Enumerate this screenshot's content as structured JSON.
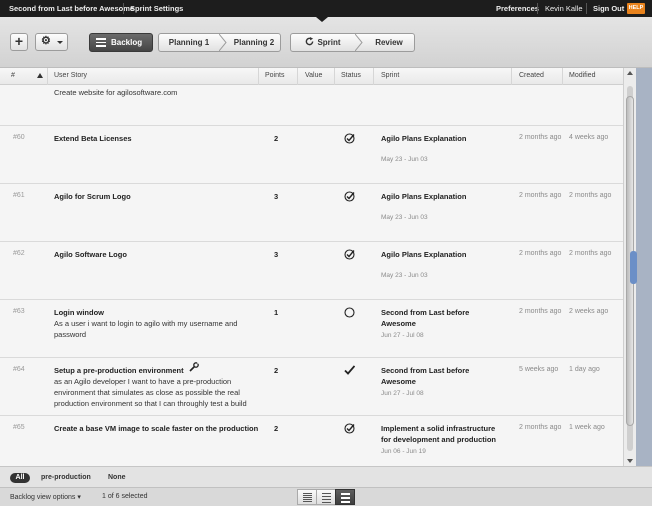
{
  "topbar": {
    "sprint_title": "Second from Last before Awesome",
    "sprint_settings": "Sprint Settings",
    "preferences": "Preferences",
    "user": "Kevin Kalle",
    "sign_out": "Sign Out",
    "help": "HELP"
  },
  "toolbar": {
    "add_label": "+",
    "gear_label": "⚙",
    "steps": {
      "backlog": "Backlog",
      "planning1": "Planning 1",
      "planning2": "Planning 2",
      "sprint": "Sprint",
      "review": "Review"
    }
  },
  "table": {
    "headers": {
      "id": "#",
      "story": "User Story",
      "points": "Points",
      "value": "Value",
      "status": "Status",
      "sprint": "Sprint",
      "created": "Created",
      "modified": "Modified"
    },
    "partial_row_desc": "Create website for agilosoftware.com",
    "rows": [
      {
        "id": "#60",
        "title": "Extend Beta Licenses",
        "desc": "",
        "points": "2",
        "status": "check-circle",
        "sprint": "Agilo Plans Explanation",
        "dates": "May 23 - Jun 03",
        "created": "2 months ago",
        "modified": "4 weeks ago"
      },
      {
        "id": "#61",
        "title": "Agilo for Scrum Logo",
        "desc": "",
        "points": "3",
        "status": "check-circle",
        "sprint": "Agilo Plans Explanation",
        "dates": "May 23 - Jun 03",
        "created": "2 months ago",
        "modified": "2 months ago"
      },
      {
        "id": "#62",
        "title": "Agilo Software Logo",
        "desc": "",
        "points": "3",
        "status": "check-circle",
        "sprint": "Agilo Plans Explanation",
        "dates": "May 23 - Jun 03",
        "created": "2 months ago",
        "modified": "2 months ago"
      },
      {
        "id": "#63",
        "title": "Login window",
        "desc": "As a user i want to login to agilo with my username and password",
        "points": "1",
        "status": "open-circle",
        "sprint": "Second from Last before Awesome",
        "dates": "Jun 27 - Jul 08",
        "created": "2 months ago",
        "modified": "2 weeks ago"
      },
      {
        "id": "#64",
        "title": "Setup a pre-production environment",
        "desc": "as an Agilo developer I want to have a pre-production environment that simulates as close as possible the real production environment so that I can throughly test a build",
        "points": "2",
        "status": "check",
        "sprint": "Second from Last before Awesome",
        "dates": "Jun 27 - Jul 08",
        "created": "5 weeks ago",
        "modified": "1 day ago"
      },
      {
        "id": "#65",
        "title": "Create a base VM image to scale faster on the production",
        "desc": "",
        "points": "2",
        "status": "check-circle",
        "sprint": "Implement a solid infrastructure for development and production",
        "dates": "Jun 06 - Jun 19",
        "created": "2 months ago",
        "modified": "1 week ago"
      }
    ]
  },
  "filters": {
    "all": "All",
    "pre_production": "pre-production",
    "none": "None"
  },
  "footer": {
    "view_options": "Backlog view options",
    "selection": "1 of 6 selected"
  }
}
